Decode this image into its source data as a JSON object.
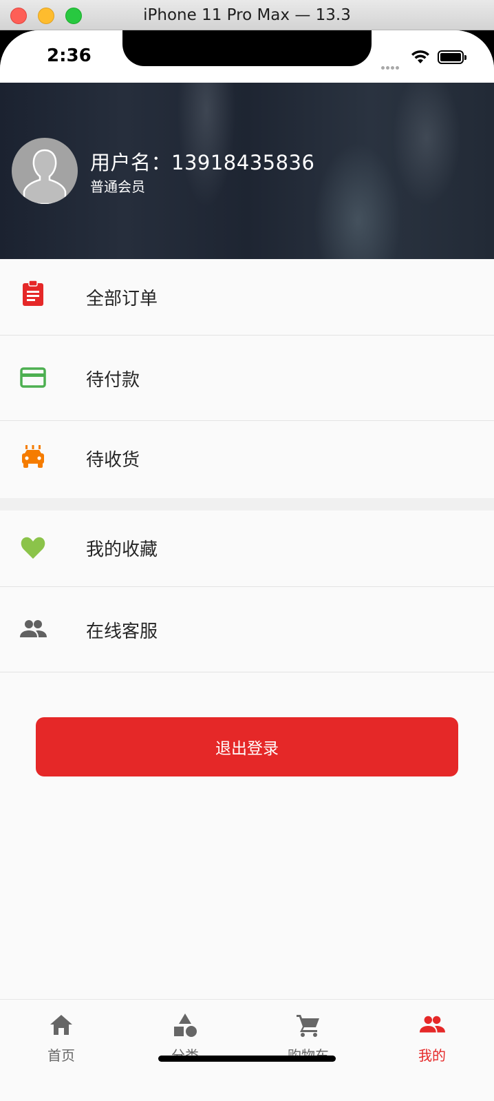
{
  "window": {
    "title": "iPhone 11 Pro Max — 13.3"
  },
  "status_bar": {
    "time": "2:36"
  },
  "profile": {
    "username_line": "用户名：13918435836",
    "member_level": "普通会员"
  },
  "menu": [
    {
      "label": "全部订单",
      "icon": "clipboard-icon",
      "color": "#e52828"
    },
    {
      "label": "待付款",
      "icon": "credit-card-icon",
      "color": "#4caf50"
    },
    {
      "label": "待收货",
      "icon": "taxi-icon",
      "color": "#f57c00"
    },
    {
      "label": "我的收藏",
      "icon": "heart-icon",
      "color": "#8bc34a"
    },
    {
      "label": "在线客服",
      "icon": "people-icon",
      "color": "#616161"
    }
  ],
  "logout_label": "退出登录",
  "tabs": [
    {
      "label": "首页",
      "icon": "home-icon"
    },
    {
      "label": "分类",
      "icon": "category-icon"
    },
    {
      "label": "购物车",
      "icon": "cart-icon"
    },
    {
      "label": "我的",
      "icon": "people-icon",
      "active": true
    }
  ],
  "colors": {
    "accent": "#e52828",
    "tab_inactive": "#666666",
    "background": "#fafafa"
  }
}
